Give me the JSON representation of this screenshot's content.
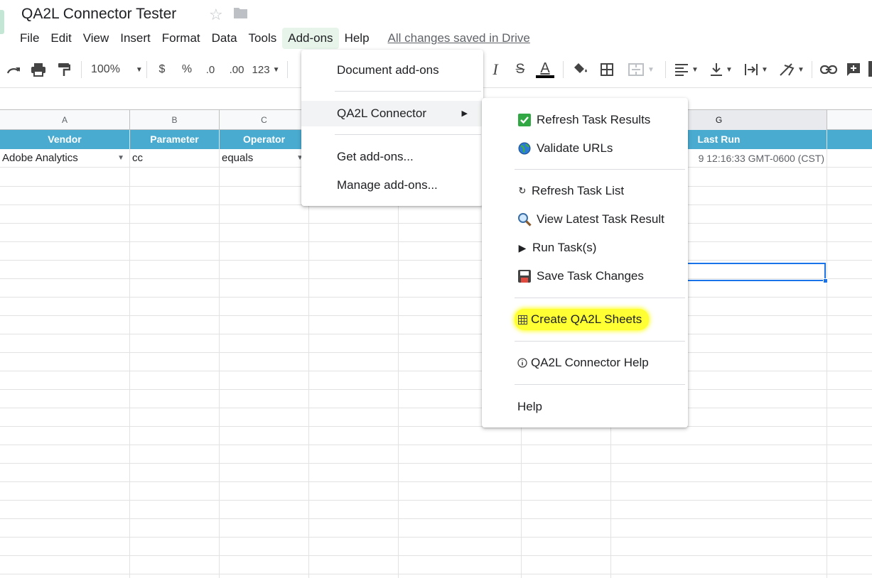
{
  "doc": {
    "title": "QA2L Connector Tester",
    "star_icon": "star-icon",
    "folder_icon": "folder-icon"
  },
  "menubar": {
    "items": [
      "File",
      "Edit",
      "View",
      "Insert",
      "Format",
      "Data",
      "Tools",
      "Add-ons",
      "Help"
    ],
    "active": "Add-ons",
    "saved_status": "All changes saved in Drive"
  },
  "toolbar": {
    "zoom": "100%",
    "currency": "$",
    "percent": "%",
    "decrease_decimal": ".0",
    "increase_decimal": ".00",
    "more_formats": "123",
    "icons": [
      "redo-icon",
      "print-icon",
      "paint-format-icon",
      "italic-icon",
      "strikethrough-icon",
      "text-color-icon",
      "fill-color-icon",
      "borders-icon",
      "merge-cells-icon",
      "align-left-icon",
      "valign-bottom-icon",
      "text-wrap-icon",
      "text-rotate-icon",
      "link-icon",
      "insert-comment-icon"
    ],
    "text_color": "#000000"
  },
  "grid": {
    "column_letters": [
      "A",
      "B",
      "C",
      "G"
    ],
    "header_row": {
      "vendor": "Vendor",
      "parameter": "Parameter",
      "operator": "Operator",
      "last_run": "Last Run"
    },
    "row_1": {
      "vendor": "Adobe Analytics",
      "parameter": "cc",
      "operator": "equals",
      "last_run": "9 12:16:33 GMT-0600 (CST)"
    },
    "header_color": "#4aabd0",
    "selection_color": "#1a73e8"
  },
  "addons_menu": {
    "items": {
      "document_addons": "Document add-ons",
      "qa2l_connector": "QA2L Connector",
      "get_addons": "Get add-ons...",
      "manage_addons": "Manage add-ons..."
    }
  },
  "connector_menu": {
    "items": [
      {
        "label": "Refresh Task Results",
        "icon": "checkmark-box-icon"
      },
      {
        "label": "Validate URLs",
        "icon": "globe-icon"
      },
      {
        "label": "Refresh Task List",
        "icon": "refresh-icon"
      },
      {
        "label": "View Latest Task Result",
        "icon": "magnifier-icon"
      },
      {
        "label": "Run Task(s)",
        "icon": "play-icon"
      },
      {
        "label": "Save Task Changes",
        "icon": "floppy-disk-icon"
      },
      {
        "label": "Create QA2L Sheets",
        "icon": "table-icon"
      },
      {
        "label": "QA2L Connector Help",
        "icon": "info-icon"
      },
      {
        "label": "Help",
        "icon": ""
      }
    ],
    "highlight_color": "#ffff33"
  }
}
